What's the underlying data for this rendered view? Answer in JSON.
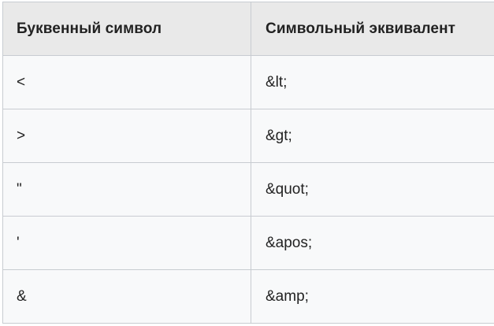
{
  "table": {
    "headers": [
      "Буквенный символ",
      "Символьный эквивалент"
    ],
    "rows": [
      [
        "<",
        "&lt;"
      ],
      [
        ">",
        "&gt;"
      ],
      [
        "\"",
        "&quot;"
      ],
      [
        "'",
        "&apos;"
      ],
      [
        "&",
        "&amp;"
      ]
    ]
  },
  "colors": {
    "header_bg": "#e9e9e9",
    "cell_bg": "#f8f9fa",
    "border": "#c8ccd1",
    "text": "#222222"
  }
}
